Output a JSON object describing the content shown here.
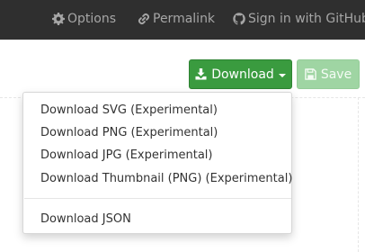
{
  "navbar": {
    "items": [
      {
        "label": "Options",
        "icon": "gear-icon"
      },
      {
        "label": "Permalink",
        "icon": "link-icon"
      },
      {
        "label": "Sign in with GitHub",
        "icon": "github-icon"
      }
    ]
  },
  "toolbar": {
    "download_label": "Download",
    "download_icon": "download-icon",
    "save_label": "Save",
    "save_icon": "floppy-disk-icon"
  },
  "download_menu": {
    "items": [
      {
        "label": "Download SVG (Experimental)"
      },
      {
        "label": "Download PNG (Experimental)"
      },
      {
        "label": "Download JPG (Experimental)"
      },
      {
        "label": "Download Thumbnail (PNG) (Experimental)"
      },
      {
        "label": "Download JSON"
      }
    ]
  },
  "colors": {
    "navbar_bg": "#2f2f2f",
    "navbar_text": "#a6a6a6",
    "primary_button": "#3a9b3f",
    "disabled_button": "#9fd5a3"
  }
}
